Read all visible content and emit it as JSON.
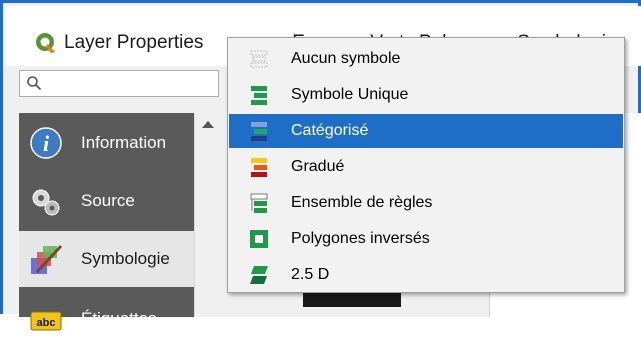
{
  "window": {
    "title": "Layer Properties",
    "title_rest": "— Espaces Verts Polygon — Symbologie"
  },
  "search": {
    "placeholder": ""
  },
  "sidebar": {
    "items": [
      {
        "label": "Information",
        "icon": "info-icon"
      },
      {
        "label": "Source",
        "icon": "source-gears-icon"
      },
      {
        "label": "Symbologie",
        "icon": "symbology-brush-icon",
        "selected": true
      },
      {
        "label": "Étiquettes",
        "icon": "labels-abc-icon"
      }
    ]
  },
  "renderer_menu": {
    "items": [
      {
        "label": "Aucun symbole",
        "icon": "no-symbol-icon"
      },
      {
        "label": "Symbole Unique",
        "icon": "single-symbol-icon"
      },
      {
        "label": "Catégorisé",
        "icon": "categorized-icon",
        "active": true
      },
      {
        "label": "Gradué",
        "icon": "graduated-icon"
      },
      {
        "label": "Ensemble de règles",
        "icon": "rule-based-icon"
      },
      {
        "label": "Polygones inversés",
        "icon": "inverted-polygons-icon"
      },
      {
        "label": "2.5 D",
        "icon": "2-5d-icon"
      }
    ]
  },
  "colors": {
    "accent": "#1e6ec8",
    "sidebar_bg": "#5a5a5a",
    "qgis_green": "#589632"
  }
}
